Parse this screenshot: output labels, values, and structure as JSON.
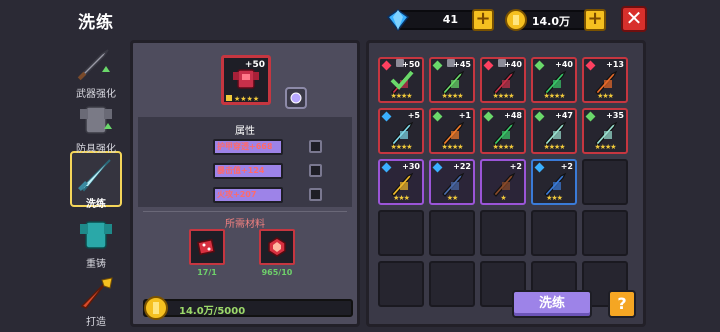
{
  "title": "洗练",
  "resources": {
    "gems": "41",
    "gold": "14.0万"
  },
  "close_label": "✕",
  "nav": [
    {
      "label": "武器强化",
      "icon": "sword-icon"
    },
    {
      "label": "防具强化",
      "icon": "armor-icon"
    },
    {
      "label": "洗练",
      "icon": "refine-sword-icon",
      "active": true
    },
    {
      "label": "重铸",
      "icon": "reforge-armor-icon"
    },
    {
      "label": "打造",
      "icon": "forge-hammer-icon"
    }
  ],
  "center": {
    "item_level": "+50",
    "item_stars": "★★★★",
    "attr_title": "属性",
    "attributes": [
      "护甲穿透+668",
      "暴击值+124",
      "火攻+207"
    ],
    "materials_title": "所需材料",
    "materials": [
      {
        "count": "17/1",
        "icon": "red-dice-icon"
      },
      {
        "count": "965/10",
        "icon": "red-gem-icon"
      }
    ],
    "gold_display": "14.0万/5000"
  },
  "inventory": [
    {
      "lv": "+50",
      "stars": "★★★★",
      "rarity": "red",
      "gem": "#ff4060",
      "icon": "red-armor-item-icon",
      "lock": true,
      "selected": true
    },
    {
      "lv": "+45",
      "stars": "★★★★",
      "rarity": "red",
      "gem": "#6ad86a",
      "icon": "green-bow-icon",
      "lock": true
    },
    {
      "lv": "+40",
      "stars": "★★★★",
      "rarity": "red",
      "gem": "#ff4060",
      "icon": "red-gun-icon",
      "lock": true
    },
    {
      "lv": "+40",
      "stars": "★★★★",
      "rarity": "red",
      "gem": "#6ad86a",
      "icon": "green-rifle-icon"
    },
    {
      "lv": "+13",
      "stars": "★★★",
      "rarity": "red",
      "gem": "#ff4060",
      "icon": "fire-spear-icon"
    },
    {
      "lv": "+5",
      "stars": "★★★★",
      "rarity": "red",
      "gem": "#3ab0ff",
      "icon": "ice-bow-icon"
    },
    {
      "lv": "+1",
      "stars": "★★★★",
      "rarity": "red",
      "gem": "#6ad86a",
      "icon": "carrot-icon"
    },
    {
      "lv": "+48",
      "stars": "★★★★",
      "rarity": "red",
      "gem": "#6ad86a",
      "icon": "green-staff-icon"
    },
    {
      "lv": "+47",
      "stars": "★★★★",
      "rarity": "red",
      "gem": "#6ad86a",
      "icon": "ghost-dragon-icon"
    },
    {
      "lv": "+35",
      "stars": "★★★★",
      "rarity": "red",
      "gem": "#6ad86a",
      "icon": "ghost-dragon-icon"
    },
    {
      "lv": "+30",
      "stars": "★★★",
      "rarity": "purple",
      "gem": "#3ab0ff",
      "icon": "gold-armor-icon"
    },
    {
      "lv": "+22",
      "stars": "★★",
      "rarity": "purple",
      "gem": "#3ab0ff",
      "icon": "shield-armor-icon"
    },
    {
      "lv": "+2",
      "stars": "★",
      "rarity": "purple",
      "gem": "",
      "icon": "crossbow-icon"
    },
    {
      "lv": "+2",
      "stars": "★★★",
      "rarity": "blue",
      "gem": "#3ab0ff",
      "icon": "blue-pistol-icon"
    }
  ],
  "wash_button": "洗练",
  "help_button": "?"
}
